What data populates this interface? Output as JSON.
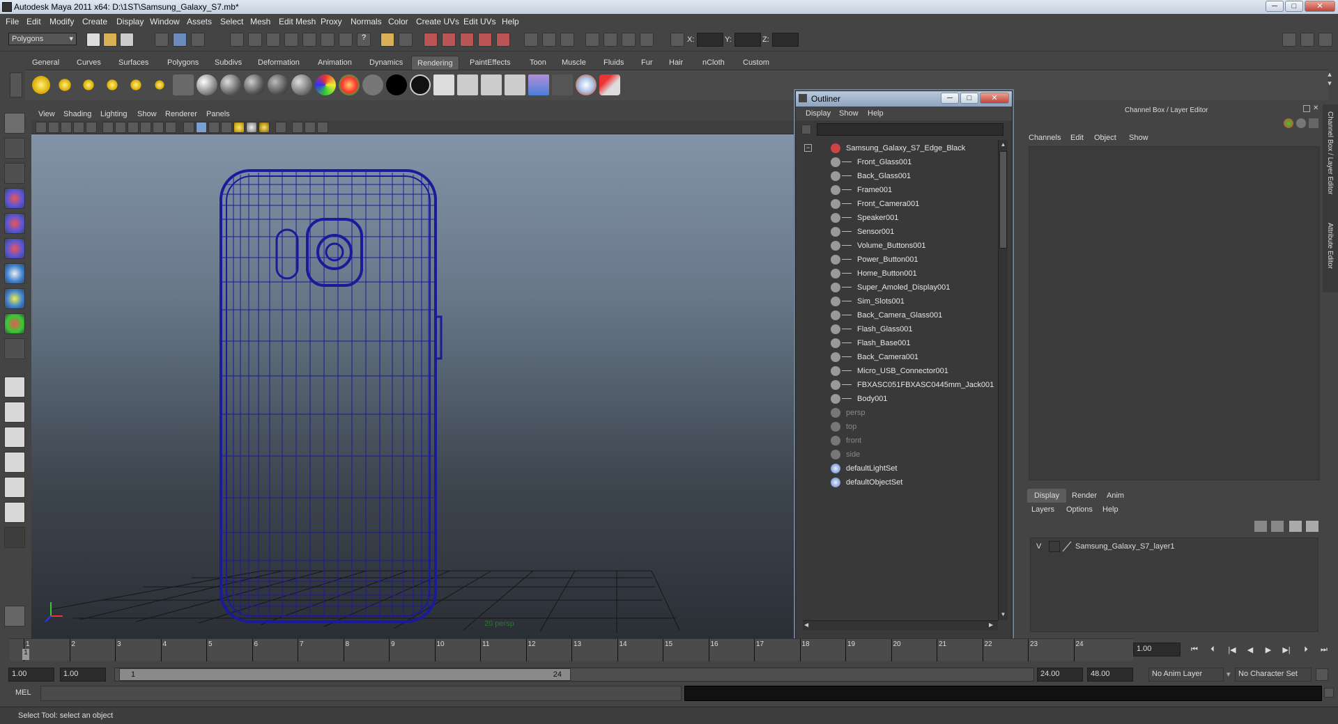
{
  "window": {
    "title": "Autodesk Maya 2011 x64: D:\\1ST\\Samsung_Galaxy_S7.mb*",
    "controls": [
      "─",
      "□",
      "✕"
    ]
  },
  "menubar": [
    "File",
    "Edit",
    "Modify",
    "Create",
    "Display",
    "Window",
    "Assets",
    "Select",
    "Mesh",
    "Edit Mesh",
    "Proxy",
    "Normals",
    "Color",
    "Create UVs",
    "Edit UVs",
    "Help"
  ],
  "status_line": {
    "mode_select": "Polygons",
    "x_label": "X:",
    "y_label": "Y:",
    "z_label": "Z:"
  },
  "shelf": {
    "tabs": [
      "General",
      "Curves",
      "Surfaces",
      "Polygons",
      "Subdivs",
      "Deformation",
      "Animation",
      "Dynamics",
      "Rendering",
      "PaintEffects",
      "Toon",
      "Muscle",
      "Fluids",
      "Fur",
      "Hair",
      "nCloth",
      "Custom"
    ],
    "active_tab": "Rendering"
  },
  "viewport": {
    "menu": [
      "View",
      "Shading",
      "Lighting",
      "Show",
      "Renderer",
      "Panels"
    ],
    "camera_label": "20 persp",
    "wire_color": "#1a1a9a"
  },
  "outliner": {
    "title": "Outliner",
    "menu": [
      "Display",
      "Show",
      "Help"
    ],
    "root": "Samsung_Galaxy_S7_Edge_Black",
    "children": [
      "Front_Glass001",
      "Back_Glass001",
      "Frame001",
      "Front_Camera001",
      "Speaker001",
      "Sensor001",
      "Volume_Buttons001",
      "Power_Button001",
      "Home_Button001",
      "Super_Amoled_Display001",
      "Sim_Slots001",
      "Back_Camera_Glass001",
      "Flash_Glass001",
      "Flash_Base001",
      "Back_Camera001",
      "Micro_USB_Connector001",
      "FBXASC051FBXASC0445mm_Jack001",
      "Body001"
    ],
    "cameras": [
      "persp",
      "top",
      "front",
      "side"
    ],
    "sets": [
      "defaultLightSet",
      "defaultObjectSet"
    ]
  },
  "channel_box": {
    "title": "Channel Box / Layer Editor",
    "menu": [
      "Channels",
      "Edit",
      "Object",
      "Show"
    ]
  },
  "layer_editor": {
    "tabs": [
      "Display",
      "Render",
      "Anim"
    ],
    "active_tab": "Display",
    "menu": [
      "Layers",
      "Options",
      "Help"
    ],
    "layer_visibility": "V",
    "layer_name": "Samsung_Galaxy_S7_layer1"
  },
  "side_tabs": [
    "Channel Box / Layer Editor",
    "Attribute Editor"
  ],
  "timeline": {
    "ticks": [
      "1",
      "2",
      "3",
      "4",
      "5",
      "6",
      "7",
      "8",
      "9",
      "10",
      "11",
      "12",
      "13",
      "14",
      "15",
      "16",
      "17",
      "18",
      "19",
      "20",
      "21",
      "22",
      "23",
      "24"
    ],
    "current_frame_marker": "1",
    "current_time": "1.00"
  },
  "range_slider": {
    "start_time": "1.00",
    "playback_start": "1.00",
    "range_start_label": "1",
    "range_end_label": "24",
    "playback_end": "24.00",
    "end_time": "48.00",
    "anim_layer": "No Anim Layer",
    "character_set": "No Character Set"
  },
  "command_line": {
    "label": "MEL"
  },
  "help_line": {
    "text": "Select Tool: select an object"
  }
}
